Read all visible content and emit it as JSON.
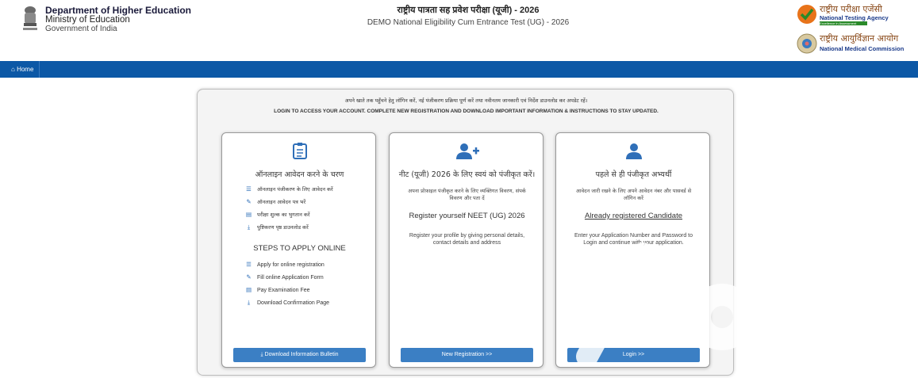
{
  "header": {
    "dept_line1": "Department of Higher Education",
    "dept_line2": "Ministry of Education",
    "dept_line3": "Government of India",
    "title_hi": "राष्ट्रीय पात्रता सह प्रवेश परीक्षा (यूजी) - 2026",
    "title_en": "DEMO National Eligibility Cum Entrance Test (UG) - 2026",
    "nta_hi": "राष्ट्रीय परीक्षा एजेंसी",
    "nta_en": "National Testing Agency",
    "nta_tag": "Excellence in Assessment",
    "nmc_hi": "राष्ट्रीय आयुर्विज्ञान आयोग",
    "nmc_en": "National Medical Commission"
  },
  "nav": {
    "home_label": "Home"
  },
  "intro": {
    "hi": "अपने खाते तक पहुँचने हेतु लॉगिन करें, नई पंजीकरण प्रक्रिया पूर्ण करें तथा नवीनतम जानकारी एवं निर्देश डाउनलोड कर अपडेट रहें।",
    "en": "LOGIN TO ACCESS YOUR ACCOUNT. COMPLETE NEW REGISTRATION AND DOWNLOAD IMPORTANT INFORMATION & INSTRUCTIONS TO STAY UPDATED."
  },
  "cards": {
    "steps": {
      "title_hi": "ऑनलाइन आवेदन करने के चरण",
      "items_hi": [
        {
          "icon": "list-icon",
          "label": "ऑनलाइन पंजीकरण के लिए आवेदन करें"
        },
        {
          "icon": "edit-icon",
          "label": "ऑनलाइन आवेदन पत्र भरें"
        },
        {
          "icon": "card-icon",
          "label": "परीक्षा शुल्क का भुगतान करें"
        },
        {
          "icon": "download-icon",
          "label": "पुष्टिकरण पृष्ठ डाउनलोड करें"
        }
      ],
      "title_en": "STEPS TO APPLY ONLINE",
      "items_en": [
        {
          "icon": "list-icon",
          "label": "Apply for online registration"
        },
        {
          "icon": "edit-icon",
          "label": "Fill online Application Form"
        },
        {
          "icon": "card-icon",
          "label": "Pay Examination Fee"
        },
        {
          "icon": "download-icon",
          "label": "Download Confirmation Page"
        }
      ],
      "button": "Download Information Bulletin"
    },
    "register": {
      "title_hi": "नीट (यूजी) 2026 के लिए स्वयं को पंजीकृत करें।",
      "sub_hi": "अपना प्रोफ़ाइल पंजीकृत करने के लिए व्यक्तिगत विवरण, संपर्क विवरण और पता दें",
      "title_en": "Register yourself NEET (UG) 2026",
      "sub_en": "Register your profile by giving personal details, contact details and address",
      "button": "New Registration >>"
    },
    "login": {
      "title_hi": "पहले से ही पंजीकृत अभ्यर्थी",
      "sub_hi": "आवेदन जारी रखने के लिए अपने आवेदन नंबर और पासवर्ड से लॉगिन करें",
      "title_en": "Already registered Candidate",
      "sub_en": "Enter your Application Number and Password to Login and continue with your application.",
      "button": "Login >>"
    }
  },
  "colors": {
    "navbar": "#0c58a6",
    "button": "#3b7fc4",
    "icon": "#2f6fb8"
  }
}
